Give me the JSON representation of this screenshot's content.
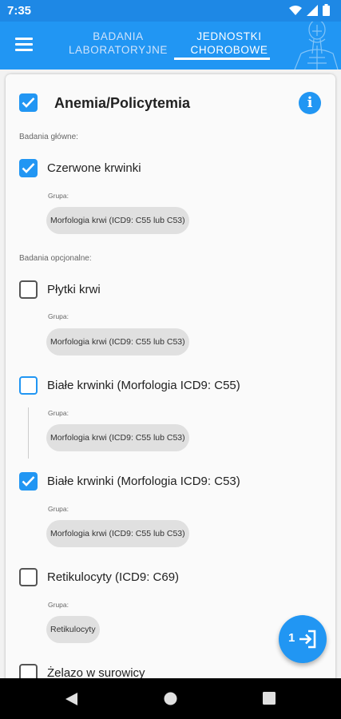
{
  "status": {
    "time": "7:35"
  },
  "tabs": [
    {
      "label_line1": "BADANIA",
      "label_line2": "LABORATORYJNE",
      "active": false
    },
    {
      "label_line1": "JEDNOSTKI",
      "label_line2": "CHOROBOWE",
      "active": true
    }
  ],
  "card": {
    "title": "Anemia/Policytemia",
    "title_checked": true,
    "main_section_label": "Badania główne:",
    "optional_section_label": "Badania opcjonalne:",
    "group_label": "Grupa:",
    "main_items": [
      {
        "label": "Czerwone krwinki",
        "checked": true,
        "group": "Morfologia krwi (ICD9: C55 lub C53)"
      }
    ],
    "optional_items": [
      {
        "label": "Płytki krwi",
        "checked": false,
        "group": "Morfologia krwi (ICD9: C55 lub C53)"
      },
      {
        "label": "Białe krwinki (Morfologia ICD9: C55)",
        "checked": false,
        "group": "Morfologia krwi (ICD9: C55 lub C53)"
      },
      {
        "label": "Białe krwinki (Morfologia ICD9: C53)",
        "checked": true,
        "group": "Morfologia krwi (ICD9: C55 lub C53)"
      },
      {
        "label": "Retikulocyty (ICD9: C69)",
        "checked": false,
        "group": "Retikulocyty"
      },
      {
        "label": "Żelazo w surowicy",
        "checked": false
      }
    ]
  },
  "fab": {
    "count": "1",
    "icon": "login-icon"
  },
  "colors": {
    "primary": "#2196f3",
    "status_bar": "#1e88e5"
  },
  "icons": {
    "menu": "hamburger-menu-icon",
    "info": "info-icon",
    "nav": [
      "back-icon",
      "home-icon",
      "recents-icon"
    ]
  }
}
